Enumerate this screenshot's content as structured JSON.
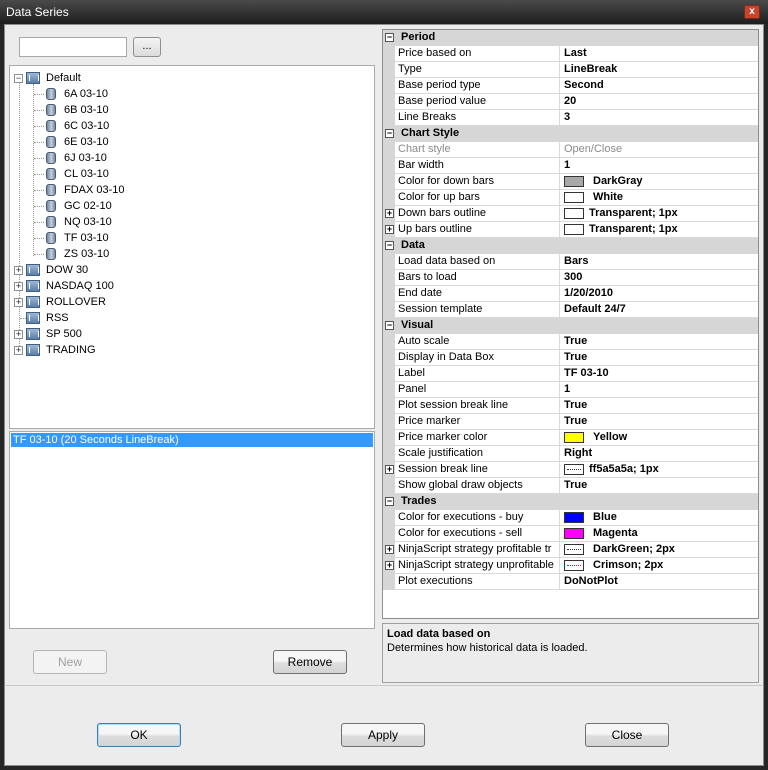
{
  "window": {
    "title": "Data Series",
    "close_glyph": "x"
  },
  "search": {
    "value": "",
    "browse_label": "..."
  },
  "tree": [
    {
      "label": "Default",
      "expander": "−"
    },
    {
      "label": "6A 03-10"
    },
    {
      "label": "6B 03-10"
    },
    {
      "label": "6C 03-10"
    },
    {
      "label": "6E 03-10"
    },
    {
      "label": "6J 03-10"
    },
    {
      "label": "CL 03-10"
    },
    {
      "label": "FDAX 03-10"
    },
    {
      "label": "GC 02-10"
    },
    {
      "label": "NQ 03-10"
    },
    {
      "label": "TF 03-10"
    },
    {
      "label": "ZS 03-10"
    },
    {
      "label": "DOW 30",
      "expander": "+"
    },
    {
      "label": "NASDAQ 100",
      "expander": "+"
    },
    {
      "label": "ROLLOVER",
      "expander": "+"
    },
    {
      "label": "RSS"
    },
    {
      "label": "SP 500",
      "expander": "+"
    },
    {
      "label": "TRADING",
      "expander": "+"
    }
  ],
  "series_list": [
    "TF 03-10 (20 Seconds LineBreak)"
  ],
  "buttons": {
    "new": "New",
    "remove": "Remove",
    "ok": "OK",
    "apply": "Apply",
    "close": "Close"
  },
  "grid": {
    "period": {
      "title": "Period",
      "glyph": "−",
      "rows": [
        {
          "name": "Price based on",
          "value": "Last"
        },
        {
          "name": "Type",
          "value": "LineBreak"
        },
        {
          "name": "Base period type",
          "value": "Second"
        },
        {
          "name": "Base period value",
          "value": "20"
        },
        {
          "name": "Line Breaks",
          "value": "3"
        }
      ]
    },
    "chart_style": {
      "title": "Chart Style",
      "glyph": "−",
      "rows": [
        {
          "name": "Chart style",
          "value": "Open/Close"
        },
        {
          "name": "Bar width",
          "value": "1"
        },
        {
          "name": "Color for down bars",
          "value": "DarkGray",
          "swatch": "#a9a9a9"
        },
        {
          "name": "Color for up bars",
          "value": "White",
          "swatch": "#ffffff"
        },
        {
          "name": "Down bars outline",
          "value": "Transparent;  1px",
          "swatch": "#ffffff",
          "expander": "+"
        },
        {
          "name": "Up bars outline",
          "value": "Transparent;  1px",
          "swatch": "#ffffff",
          "expander": "+"
        }
      ]
    },
    "data": {
      "title": "Data",
      "glyph": "−",
      "rows": [
        {
          "name": "Load data based on",
          "value": "Bars"
        },
        {
          "name": "Bars to load",
          "value": "300"
        },
        {
          "name": "End date",
          "value": "1/20/2010"
        },
        {
          "name": "Session template",
          "value": "Default 24/7"
        }
      ]
    },
    "visual": {
      "title": "Visual",
      "glyph": "−",
      "rows": [
        {
          "name": "Auto scale",
          "value": "True"
        },
        {
          "name": "Display in Data Box",
          "value": "True"
        },
        {
          "name": "Label",
          "value": "TF 03-10"
        },
        {
          "name": "Panel",
          "value": "1"
        },
        {
          "name": "Plot session break line",
          "value": "True"
        },
        {
          "name": "Price marker",
          "value": "True"
        },
        {
          "name": "Price marker color",
          "value": "Yellow",
          "swatch": "#ffff00"
        },
        {
          "name": "Scale justification",
          "value": "Right"
        },
        {
          "name": "Session break line",
          "value": "ff5a5a5a;  1px",
          "swatch": "#ffffff",
          "expander": "+"
        },
        {
          "name": "Show global draw objects",
          "value": "True"
        }
      ]
    },
    "trades": {
      "title": "Trades",
      "glyph": "−",
      "rows": [
        {
          "name": "Color for executions - buy",
          "value": "Blue",
          "swatch": "#0000ff"
        },
        {
          "name": "Color for executions - sell",
          "value": "Magenta",
          "swatch": "#ff00ff"
        },
        {
          "name": "NinjaScript strategy profitable tr",
          "value": "DarkGreen;  2px",
          "swatch": "#ffffff",
          "expander": "+"
        },
        {
          "name": "NinjaScript strategy unprofitable",
          "value": "Crimson;  2px",
          "swatch": "#ffffff",
          "expander": "+"
        },
        {
          "name": "Plot executions",
          "value": "DoNotPlot"
        }
      ]
    }
  },
  "help": {
    "title": "Load data based on",
    "text": "Determines how historical data is loaded."
  }
}
